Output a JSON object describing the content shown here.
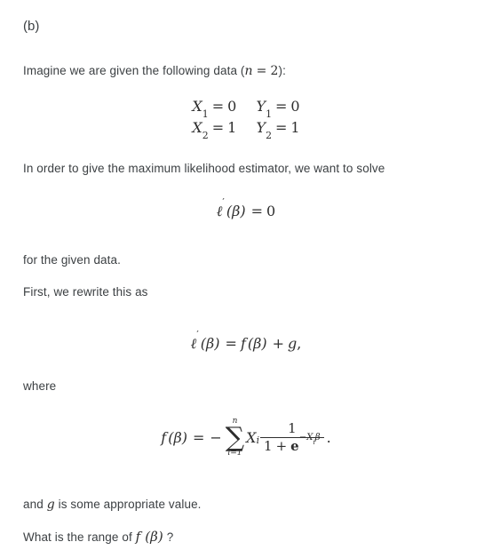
{
  "document": {
    "part_label": "(b)",
    "background_color": "#ffffff",
    "text_color": "#3c4043",
    "math_color": "#2e2e2e"
  },
  "paragraphs": {
    "intro_prefix": "Imagine we are given the following data (",
    "intro_suffix": "):",
    "intro_inline_math": "n = 2",
    "solve_sentence": "In order to give the maximum likelihood estimator, we want to solve",
    "for_given_data": "for the given data.",
    "rewrite_sentence": "First, we rewrite this as",
    "where_label": "where",
    "g_sentence_prefix": "and ",
    "g_sentence_math": "g",
    "g_sentence_suffix": " is some appropriate value.",
    "question_prefix": "What is the range of ",
    "question_math": "f (β)",
    "question_suffix": " ?"
  },
  "data_block": {
    "rows": [
      {
        "x_var": "X",
        "x_index": "1",
        "x_eq": "=",
        "x_value": "0",
        "y_var": "Y",
        "y_index": "1",
        "y_eq": "=",
        "y_value": "0"
      },
      {
        "x_var": "X",
        "x_index": "2",
        "x_eq": "=",
        "x_value": "1",
        "y_var": "Y",
        "y_index": "2",
        "y_eq": "=",
        "y_value": "1"
      }
    ]
  },
  "equations": {
    "score_equation": {
      "lhs_ell": "ℓ",
      "lhs_prime": "′",
      "lhs_arg": "(β)",
      "relation": "=",
      "rhs": "0"
    },
    "decomposition": {
      "lhs_ell": "ℓ",
      "lhs_prime": "′",
      "lhs_arg": "(β)",
      "relation": "=",
      "term_f": "f",
      "term_f_arg": "(β)",
      "plus": "+",
      "term_g": "g",
      "punctuation": ","
    },
    "f_definition": {
      "lhs_f": "f",
      "lhs_arg": "(β)",
      "relation": "=",
      "minus": "−",
      "sigma": "∑",
      "sigma_upper": "n",
      "sigma_lower": "i=1",
      "summand_var": "X",
      "summand_index": "i",
      "fraction_numerator": "1",
      "fraction_denominator_one": "1",
      "fraction_denominator_plus": "+",
      "fraction_denominator_e": "e",
      "fraction_denominator_exponent": "−X",
      "fraction_denominator_exponent_index": "i",
      "fraction_denominator_exponent_beta": "β",
      "punctuation": "."
    }
  }
}
